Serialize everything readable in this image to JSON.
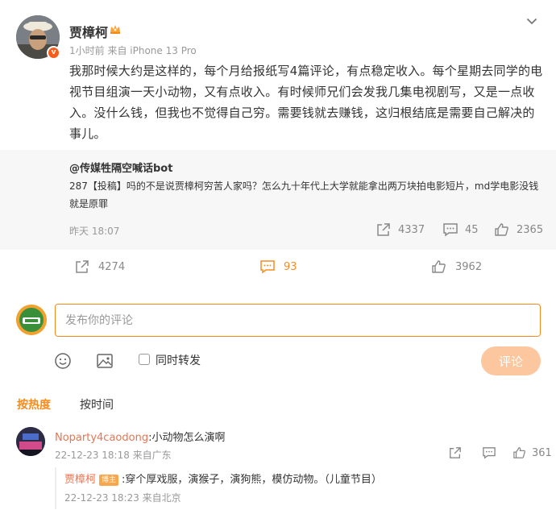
{
  "post": {
    "author": "贾樟柯",
    "time": "1小时前",
    "source": "来自 iPhone 13 Pro",
    "text": "我那时候大约是这样的，每个月给报纸写4篇评论，有点稳定收入。每个星期去同学的电视节目组演一天小动物，又有点收入。有时候师兄们会发我几集电视剧写，又是一点收入。没什么钱，但我也不觉得自己穷。需要钱就去赚钱，这归根结底是需要自己解决的事儿。"
  },
  "repost": {
    "author": "@传媒牲隔空喊话bot",
    "text": "287【投稿】吗的不是说贾樟柯穷苦人家吗？怎么九十年代上大学就能拿出两万块拍电影短片，md学电影没钱就是原罪",
    "time": "昨天 18:07",
    "forwards": "4337",
    "comments": "45",
    "likes": "2365"
  },
  "actions": {
    "forwards": "4274",
    "comments": "93",
    "likes": "3962"
  },
  "composer": {
    "placeholder": "发布你的评论",
    "forward_label": "同时转发",
    "submit_label": "评论"
  },
  "sort": {
    "hot": "按热度",
    "time": "按时间"
  },
  "comments": [
    {
      "user": "Noparty4caodong",
      "text": ":小动物怎么演啊",
      "time": "22-12-23 18:18 来自广东",
      "likes": "361",
      "reply": {
        "user": "贾樟柯",
        "badge": "博主",
        "text": ":穿个厚戏服，演猴子，演狗熊，模仿动物。（儿童节目）",
        "time": "22-12-23 18:23 来自北京"
      }
    }
  ],
  "colors": {
    "accent": "#f78b1e",
    "username": "#eb7350",
    "submit_disabled": "#fcc79f",
    "muted": "#999999"
  }
}
